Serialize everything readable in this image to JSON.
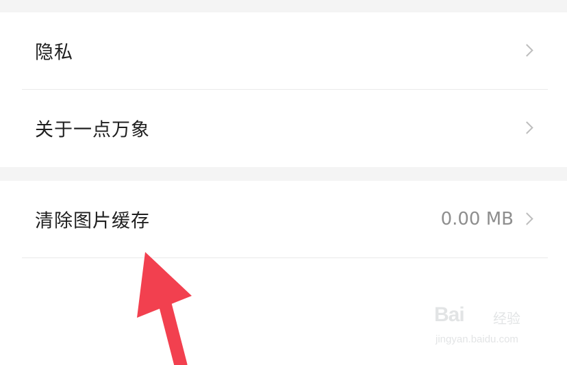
{
  "settings": {
    "group1": [
      {
        "label": "隐私"
      },
      {
        "label": "关于一点万象"
      }
    ],
    "group2": [
      {
        "label": "清除图片缓存",
        "value": "0.00 MB"
      }
    ]
  },
  "watermark": {
    "brand": "Bai",
    "sub": "经验",
    "url": "jingyan.baidu.com"
  },
  "colors": {
    "background": "#ffffff",
    "section_gap": "#f4f4f4",
    "text_primary": "#1f1f1f",
    "text_secondary": "#8e8e8e",
    "chevron": "#bdbdbd",
    "annotation_arrow": "#f2404f"
  }
}
